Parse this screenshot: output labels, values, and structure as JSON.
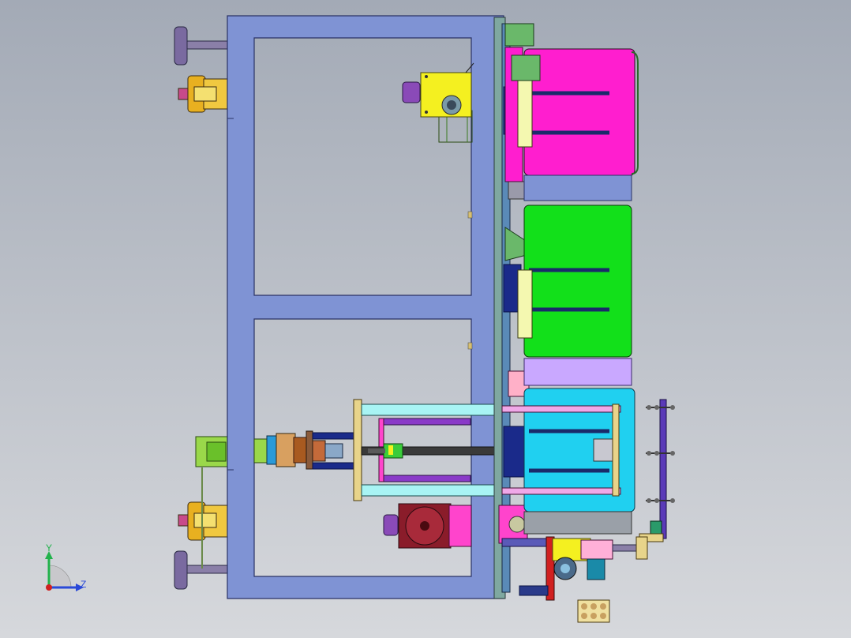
{
  "viewport": {
    "background_top": "#a3aab6",
    "background_bottom": "#d6d8dc"
  },
  "triad": {
    "y_label": "Y",
    "z_label": "Z",
    "y_color": "#22b24c",
    "z_color": "#2a49d8",
    "x_color": "#d02020"
  },
  "colors": {
    "frame": "#7f93d4",
    "frame_stroke": "#2a3366",
    "magenta": "#ff1ecf",
    "green": "#12e01a",
    "cyan": "#20d0f0",
    "lavender": "#c9a8ff",
    "yellow": "#f4f020",
    "orange_gold": "#e8b020",
    "purple": "#6a3aa8",
    "navy": "#1a2a8a",
    "pink": "#ff66cc",
    "olive_green": "#9ec37a",
    "tan": "#e8d48a",
    "brown": "#a85a20",
    "maroon": "#8a1c2a",
    "light_cyan": "#a8f4f4",
    "grey_rail": "#9aa0a8"
  }
}
